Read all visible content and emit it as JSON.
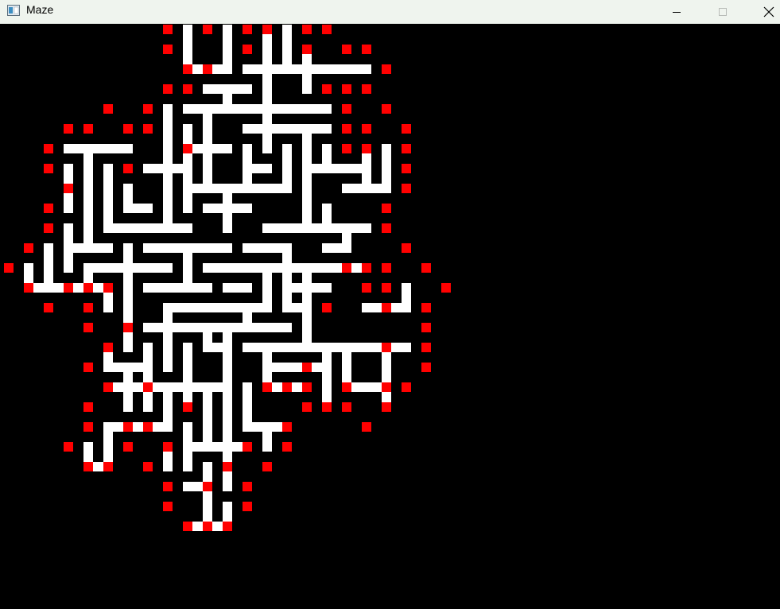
{
  "window": {
    "title": "Maze",
    "icon": "app-window-icon",
    "controls": [
      "minimize-icon",
      "maximize-icon",
      "close-icon"
    ]
  },
  "maze": {
    "background_color": "#000000",
    "path_color": "#ffffff",
    "frontier_color": "#ff0000"
  }
}
